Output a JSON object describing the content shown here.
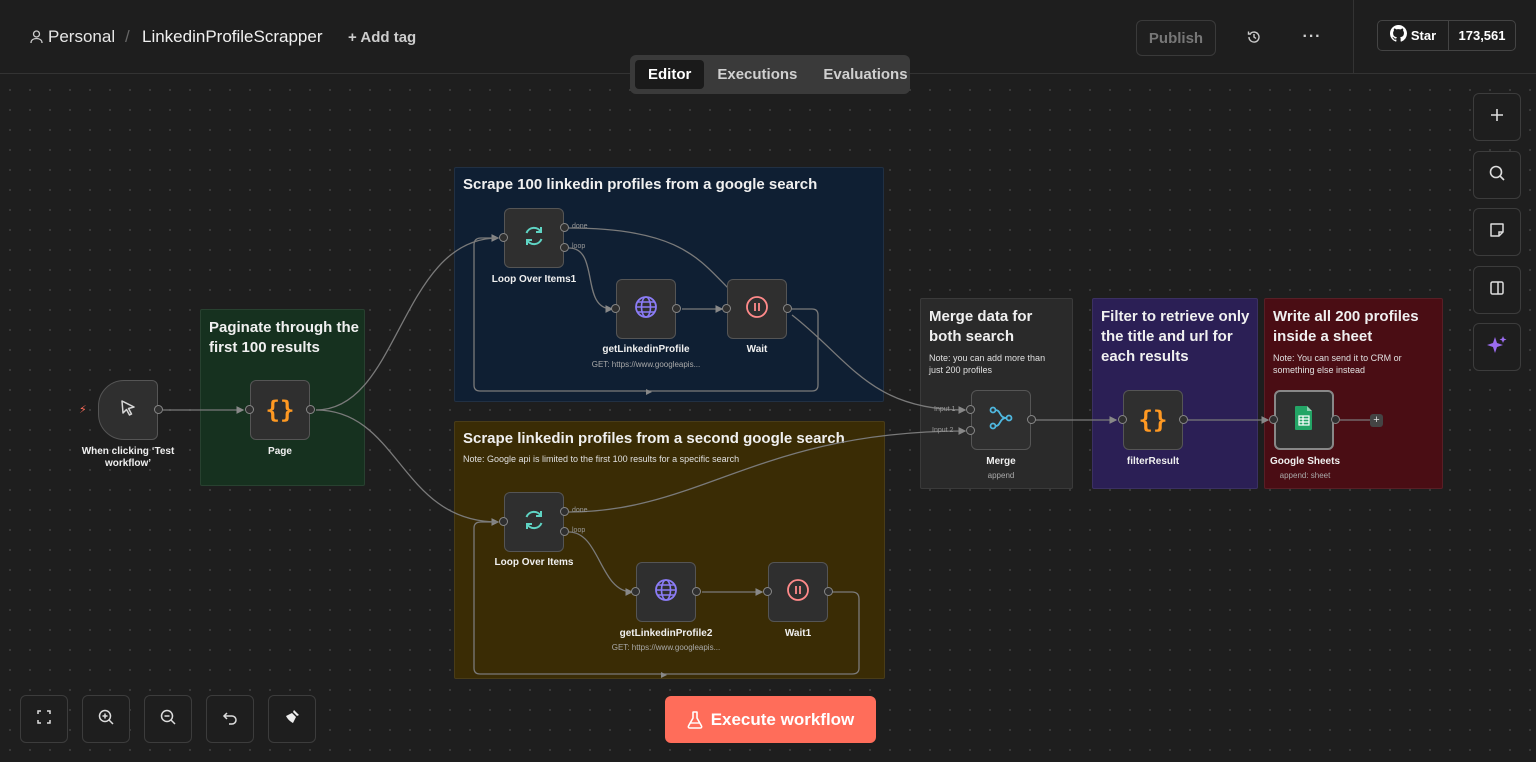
{
  "header": {
    "workspace": "Personal",
    "separator": "/",
    "workflow_name": "LinkedinProfileScrapper",
    "add_tag": "+ Add tag",
    "publish": "Publish",
    "github_star": "Star",
    "github_count": "173,561"
  },
  "tabs": [
    {
      "label": "Editor",
      "active": true
    },
    {
      "label": "Executions",
      "active": false
    },
    {
      "label": "Evaluations",
      "active": false
    }
  ],
  "stickies": {
    "scrape1": {
      "title": "Scrape 100 linkedin profiles from a google search"
    },
    "paginate": {
      "title_line1": "Paginate through the",
      "title_line2": "first 100 results"
    },
    "scrape2": {
      "title": "Scrape linkedin profiles from a second google search",
      "note": "Note: Google api is limited to the first 100 results for a specific search"
    },
    "merge": {
      "title_line1": "Merge data for",
      "title_line2": "both search",
      "note_line1": "Note: you can add more than",
      "note_line2": "just 200 profiles"
    },
    "filter": {
      "title_line1": "Filter to retrieve only",
      "title_line2": "the title and url for",
      "title_line3": "each results"
    },
    "write": {
      "title_line1": "Write all 200 profiles",
      "title_line2": "inside a sheet",
      "note_line1": "Note: You can send it to CRM or",
      "note_line2": "something else instead"
    }
  },
  "nodes": {
    "trigger": {
      "label_line1": "When clicking ‘Test",
      "label_line2": "workflow’"
    },
    "page": {
      "label": "Page"
    },
    "loop1": {
      "label": "Loop Over Items1",
      "done": "done",
      "loop": "loop"
    },
    "get1": {
      "label": "getLinkedinProfile",
      "sub": "GET: https://www.googleapis..."
    },
    "wait": {
      "label": "Wait"
    },
    "loop2": {
      "label": "Loop Over Items",
      "done": "done",
      "loop": "loop"
    },
    "get2": {
      "label": "getLinkedinProfile2",
      "sub": "GET: https://www.googleapis..."
    },
    "wait1": {
      "label": "Wait1"
    },
    "merge": {
      "label": "Merge",
      "sub": "append",
      "input1": "Input 1",
      "input2": "Input 2"
    },
    "filter": {
      "label": "filterResult"
    },
    "sheets": {
      "label": "Google Sheets",
      "sub": "append: sheet"
    }
  },
  "execute": {
    "label": "Execute workflow"
  },
  "colors": {
    "accent": "#ff6d5a",
    "sticky_blue": "#0f1f33",
    "sticky_green": "#16311f",
    "sticky_yellow": "#3a2c05",
    "sticky_gray": "#2a2a2a",
    "sticky_purple": "#2b1f55",
    "sticky_red": "#4a0d14"
  }
}
